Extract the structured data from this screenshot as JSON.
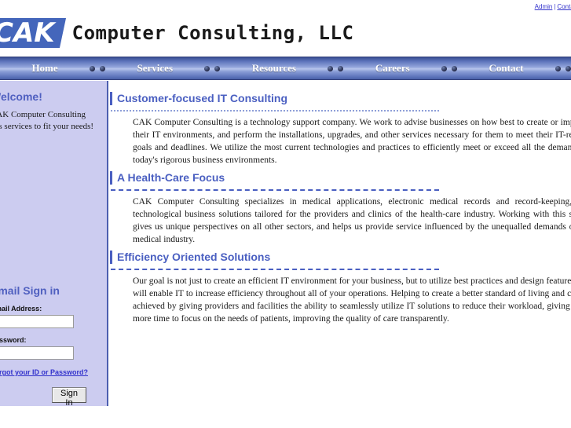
{
  "topbar": {
    "admin_label": "Admin",
    "separator": "|",
    "second_label": "Contact Us"
  },
  "logo": {
    "badge_text": "CAK",
    "company_text": "Computer Consulting, LLC",
    "badge_color": "#4466bb"
  },
  "nav": {
    "items": [
      {
        "label": "Home"
      },
      {
        "label": "Services"
      },
      {
        "label": "Resources"
      },
      {
        "label": "Careers"
      },
      {
        "label": "Contact"
      }
    ]
  },
  "sidebar": {
    "welcome_heading": "Welcome!",
    "welcome_text": "CAK Computer Consulting has services to fit your needs!",
    "signin": {
      "heading": "Email Sign in",
      "email_label": "Email Address:",
      "email_value": "",
      "email_placeholder": "",
      "password_label": "Password:",
      "password_value": "",
      "password_placeholder": "",
      "forgot_link": "Forgot your ID or Password?",
      "submit_label": "Sign In"
    }
  },
  "content": {
    "sections": [
      {
        "heading": "Customer-focused IT Consulting",
        "divider_style": "dotted",
        "body": "CAK Computer Consulting is a technology support company. We work to advise businesses on how best to create or improve their IT environments, and perform the installations, upgrades, and other services necessary for them to meet their IT-related goals and deadlines. We utilize the most current technologies and practices to efficiently meet or exceed all the demands of today's rigorous business environments."
      },
      {
        "heading": "A Health-Care Focus",
        "divider_style": "dashed",
        "body": "CAK Computer Consulting specializes in medical applications, electronic medical records and record-keeping, and technological business solutions tailored for the providers and clinics of the health-care industry. Working with this sector gives us unique perspectives on all other sectors, and helps us provide service influenced by the unequalled demands of the medical industry."
      },
      {
        "heading": "Efficiency Oriented Solutions",
        "divider_style": "dashed",
        "body": "Our goal is not just to create an efficient IT environment for your business, but to utilize best practices and design features that will enable IT to increase efficiency throughout all of your operations. Helping to create a better standard of living and care is achieved by giving providers and facilities the ability to seamlessly utilize IT solutions to reduce their workload, giving them more time to focus on the needs of patients, improving the quality of care transparently."
      }
    ]
  },
  "colors": {
    "accent_blue": "#4a5fc1",
    "nav_dark": "#3a4f93",
    "sidebar_bg": "#ccccf0",
    "link_blue": "#3333cc"
  }
}
